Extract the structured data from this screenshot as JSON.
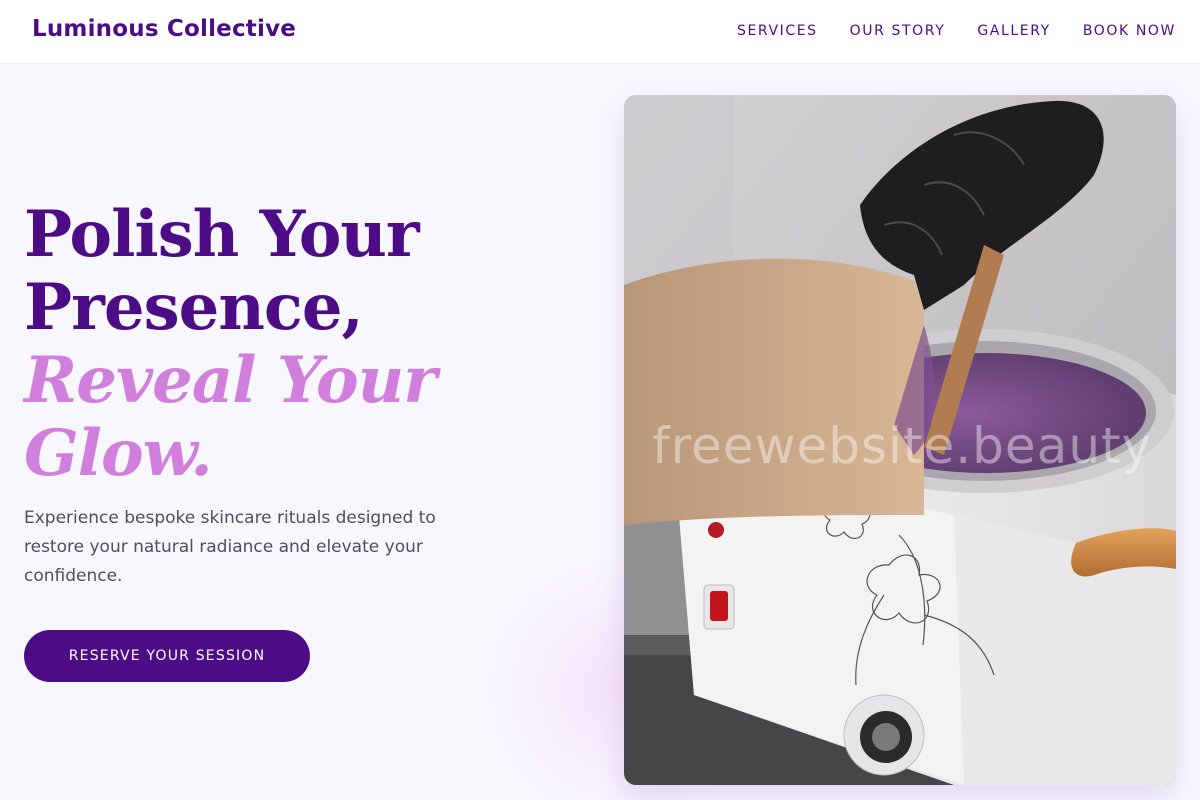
{
  "header": {
    "brand": "Luminous Collective",
    "nav": [
      {
        "label": "SERVICES"
      },
      {
        "label": "OUR STORY"
      },
      {
        "label": "GALLERY"
      },
      {
        "label": "BOOK NOW"
      }
    ]
  },
  "hero": {
    "headline": {
      "line1": "Polish Your",
      "line2": "Presence,",
      "accent1": "Reveal Your",
      "accent2": "Glow."
    },
    "tagline": "Experience bespoke skincare rituals designed to restore your natural radiance and elevate your confidence.",
    "cta_label": "RESERVE YOUR SESSION"
  },
  "image": {
    "watermark": "freewebsite.beauty"
  },
  "colors": {
    "brand": "#4b0c86",
    "accent": "#d07fdc",
    "background": "#f8f7fe"
  }
}
